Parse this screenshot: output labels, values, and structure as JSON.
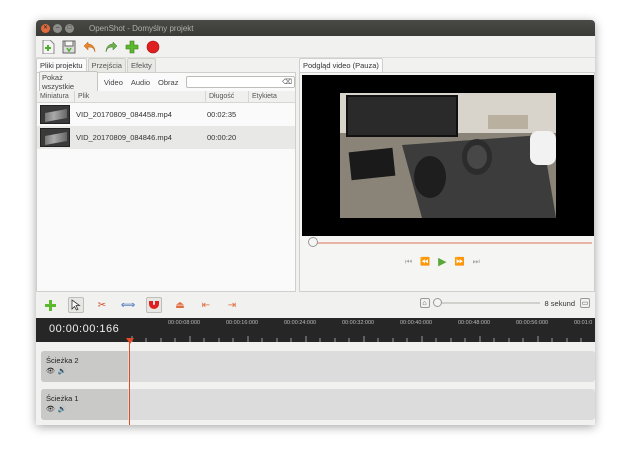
{
  "window": {
    "title": "OpenShot - Domyślny projekt"
  },
  "toolbar": {
    "icons": [
      "new-project-icon",
      "save-project-icon",
      "undo-icon",
      "redo-icon",
      "import-files-icon",
      "record-icon"
    ]
  },
  "left_tabs": [
    "Pliki projektu",
    "Przejścia",
    "Efekty"
  ],
  "filters": {
    "show_all": "Pokaż wszystkie",
    "video": "Video",
    "audio": "Audio",
    "image": "Obraz",
    "search_value": ""
  },
  "files_table": {
    "columns": [
      "Miniatura",
      "Plik",
      "Długość",
      "Etykieta"
    ],
    "rows": [
      {
        "file": "VID_20170809_084458.mp4",
        "length": "00:02:35",
        "tag": ""
      },
      {
        "file": "VID_20170809_084846.mp4",
        "length": "00:00:20",
        "tag": ""
      }
    ]
  },
  "preview": {
    "tab": "Podgląd video (Pauza)"
  },
  "timeline": {
    "timecode": "00:00:00:166",
    "zoom_label": "8 sekund",
    "ticks": [
      "00:00:08:000",
      "00:00:16:000",
      "00:00:24:000",
      "00:00:32:000",
      "00:00:40:000",
      "00:00:48:000",
      "00:00:56:000",
      "00:01:0"
    ],
    "tracks": [
      "Ścieżka 2",
      "Ścieżka 1"
    ]
  },
  "colors": {
    "accent": "#e26b3d",
    "play": "#5aa83a",
    "playhead": "#e24a2a"
  }
}
